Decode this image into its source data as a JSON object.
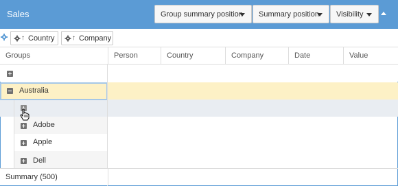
{
  "header": {
    "title": "Sales",
    "group_summary_position_label": "Group summary position",
    "summary_position_label": "Summary position",
    "visibility_label": "Visibility",
    "accent_color": "#5b9bd5"
  },
  "group_panel": {
    "chips": [
      {
        "label": "Country",
        "icons": [
          "gear-icon",
          "sort-ascending-icon"
        ]
      },
      {
        "label": "Company",
        "icons": [
          "gear-icon",
          "sort-ascending-icon"
        ]
      }
    ]
  },
  "columns": [
    "Groups",
    "Person",
    "Country",
    "Company",
    "Date",
    "Value"
  ],
  "tree": [
    {
      "level": 0,
      "label": "",
      "state": "collapsed"
    },
    {
      "level": 0,
      "label": "Australia",
      "state": "expanded",
      "selected": true
    },
    {
      "level": 1,
      "label": "",
      "state": "collapsed",
      "hovered": true
    },
    {
      "level": 1,
      "label": "Adobe",
      "state": "collapsed"
    },
    {
      "level": 1,
      "label": "Apple",
      "state": "collapsed"
    },
    {
      "level": 1,
      "label": "Dell",
      "state": "collapsed"
    }
  ],
  "summary": {
    "label": "Summary (500)"
  },
  "colors": {
    "selected_row": "#fdf1c6",
    "selected_border": "#a5c7e7",
    "hover_row": "#e9edf2",
    "alt_row": "#f5f5f5"
  }
}
